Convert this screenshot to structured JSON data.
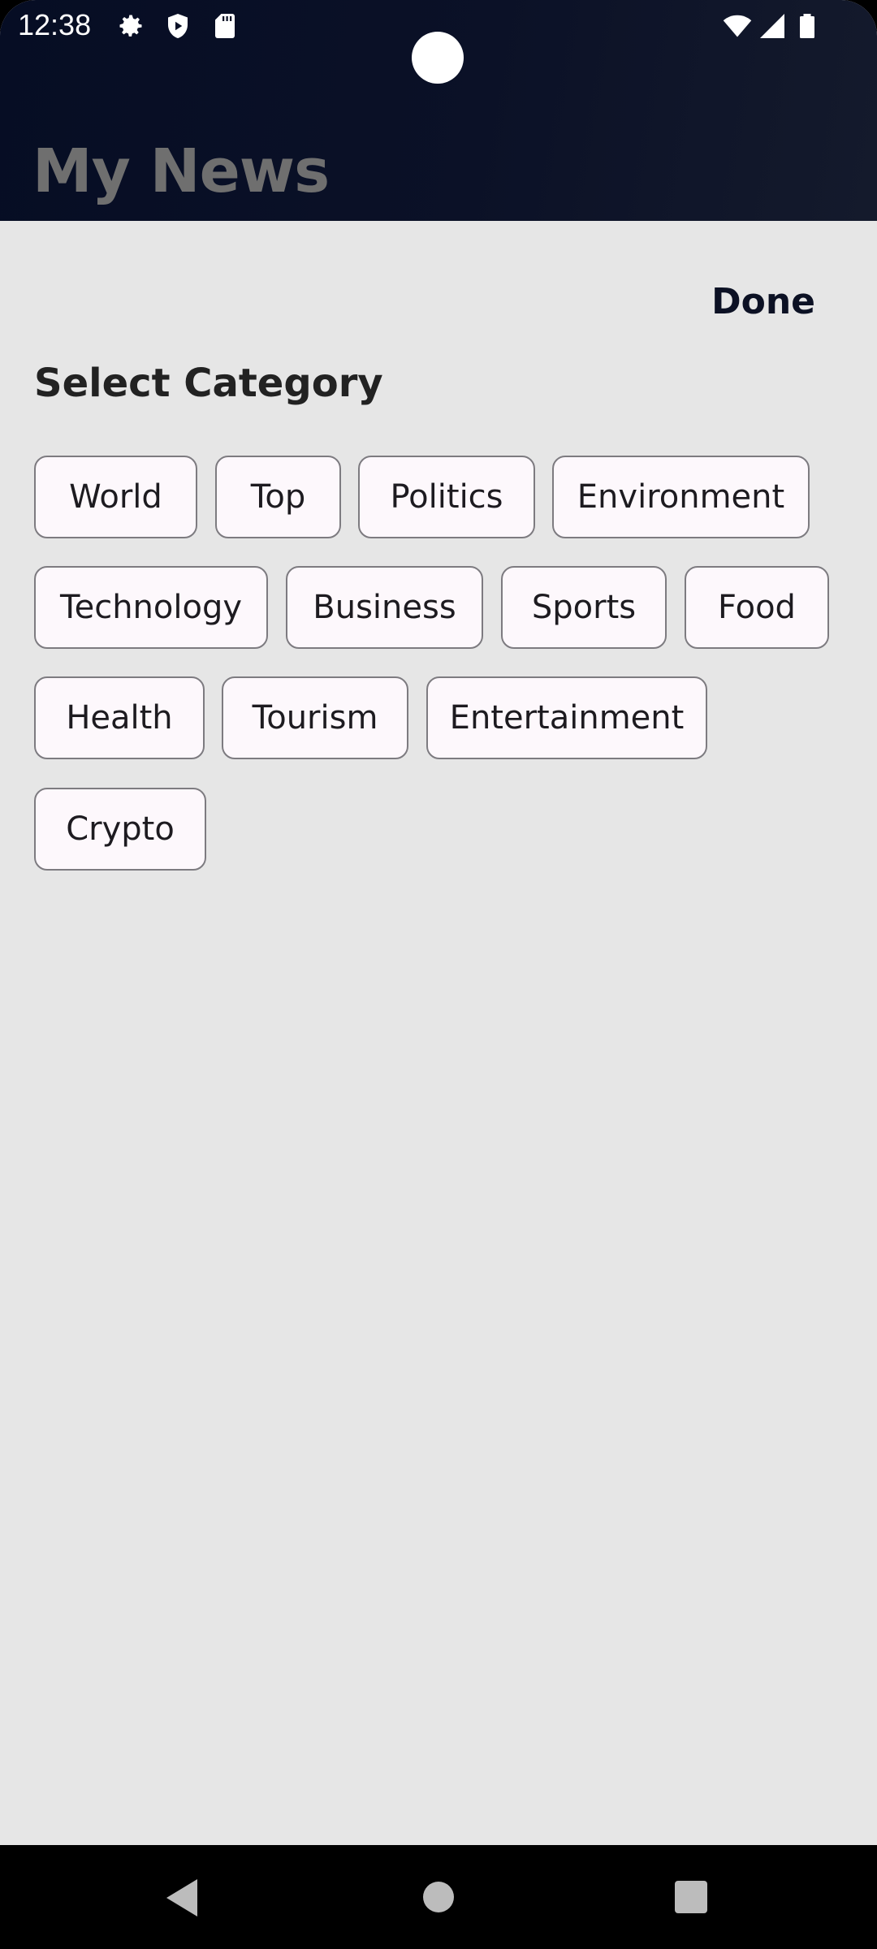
{
  "status_bar": {
    "time": "12:38",
    "left_icons": [
      "gear-icon",
      "shield-play-icon",
      "sd-card-icon"
    ],
    "right_icons": [
      "wifi-icon",
      "signal-icon",
      "battery-icon"
    ]
  },
  "header": {
    "title": "My News"
  },
  "sheet": {
    "done_label": "Done",
    "section_title": "Select Category",
    "categories": [
      "World",
      "Top",
      "Politics",
      "Environment",
      "Technology",
      "Business",
      "Sports",
      "Food",
      "Health",
      "Tourism",
      "Entertainment",
      "Crypto"
    ]
  },
  "nav_bar": {
    "icons": [
      "back-icon",
      "home-icon",
      "recents-icon"
    ]
  },
  "colors": {
    "header_bg": "#0b1127",
    "title_text": "#6f6f6f",
    "sheet_bg": "#e6e6e6",
    "chip_bg": "#fdf8fc",
    "chip_border": "#7d7b80",
    "done_text": "#0c1124"
  }
}
